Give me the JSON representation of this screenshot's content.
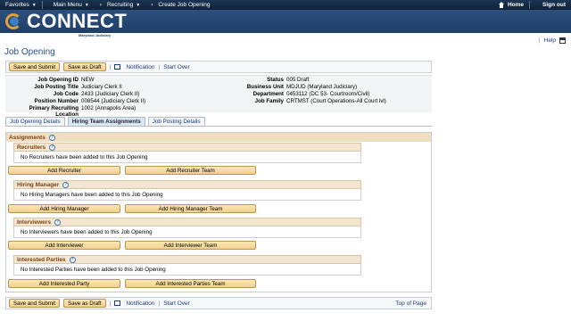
{
  "nav": {
    "favorites": "Favorites",
    "main_menu": "Main Menu",
    "recruiting": "Recruiting",
    "crumb": "Create Job Opening",
    "home": "Home",
    "sign_out": "Sign out"
  },
  "brand": {
    "name": "CONNECT",
    "sub": "Maryland Judiciary"
  },
  "help": {
    "label": "Help"
  },
  "page": {
    "title": "Job Opening"
  },
  "toolbar": {
    "save_submit": "Save and Submit",
    "save_draft": "Save as Draft",
    "notification": "Notification",
    "start_over": "Start Over",
    "top_of_page": "Top of Page"
  },
  "info": {
    "left": [
      {
        "label": "Job Opening ID",
        "value": "NEW"
      },
      {
        "label": "Job Posting Title",
        "value": "Judiciary Clerk II"
      },
      {
        "label": "Job Code",
        "value": "2433 (Judiciary Clerk II)"
      },
      {
        "label": "Position Number",
        "value": "008544 (Judiciary Clerk II)"
      },
      {
        "label": "Primary Recruiting Location",
        "value": "1002 (Annapolis Area)"
      }
    ],
    "right": [
      {
        "label": "Status",
        "value": "005 Draft"
      },
      {
        "label": "Business Unit",
        "value": "MDJUD (Maryland Judiciary)"
      },
      {
        "label": "Department",
        "value": "0453112 (DC 53- Courtroom/Civil)"
      },
      {
        "label": "Job Family",
        "value": "CRTMST (Court Operations-All Court lvl)"
      }
    ]
  },
  "tabs": [
    "Job Opening Details",
    "Hiring Team Assignments",
    "Job Posting Details"
  ],
  "assignments": {
    "title": "Assignments",
    "sections": [
      {
        "title": "Recruiters",
        "message": "No Recruiters have been added to this Job Opening",
        "btn1": "Add Recruiter",
        "btn2": "Add Recruiter Team"
      },
      {
        "title": "Hiring Manager",
        "message": "No Hiring Managers have been added to this Job Opening",
        "btn1": "Add Hiring Manager",
        "btn2": "Add Hiring Manager Team"
      },
      {
        "title": "Interviewers",
        "message": "No Interviewers have been added to this Job Opening",
        "btn1": "Add Interviewer",
        "btn2": "Add Interviewer Team"
      },
      {
        "title": "Interested Parties",
        "message": "No Interested Parties have been added to this Job Opening",
        "btn1": "Add Interested Party",
        "btn2": "Add Interested Parties Team"
      }
    ]
  }
}
